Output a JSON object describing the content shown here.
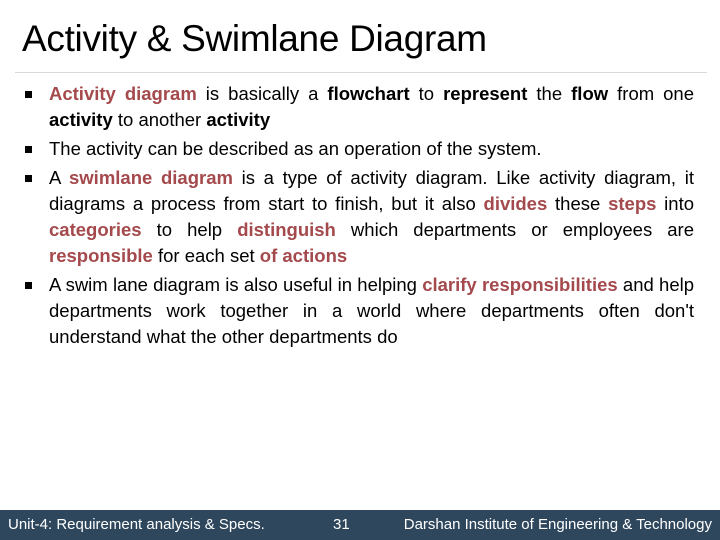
{
  "slide": {
    "title": "Activity & Swimlane Diagram",
    "bullets": [
      {
        "segments": [
          {
            "text": "Activity diagram",
            "style": "highlight"
          },
          {
            "text": " is basically a ",
            "style": "normal"
          },
          {
            "text": "flowchart",
            "style": "bold"
          },
          {
            "text": " to ",
            "style": "normal"
          },
          {
            "text": "represent",
            "style": "bold"
          },
          {
            "text": " the ",
            "style": "normal"
          },
          {
            "text": "flow",
            "style": "bold"
          },
          {
            "text": " from one ",
            "style": "normal"
          },
          {
            "text": "activity",
            "style": "bold"
          },
          {
            "text": " to another ",
            "style": "normal"
          },
          {
            "text": "activity",
            "style": "bold"
          }
        ]
      },
      {
        "segments": [
          {
            "text": "The activity can be described as an operation of the system.",
            "style": "normal"
          }
        ]
      },
      {
        "segments": [
          {
            "text": "A ",
            "style": "normal"
          },
          {
            "text": "swimlane diagram",
            "style": "highlight"
          },
          {
            "text": " is a type of activity diagram. Like activity diagram, it diagrams a process from start to finish, but it also ",
            "style": "normal"
          },
          {
            "text": "divides",
            "style": "highlight"
          },
          {
            "text": " these ",
            "style": "normal"
          },
          {
            "text": "steps",
            "style": "highlight"
          },
          {
            "text": " into ",
            "style": "normal"
          },
          {
            "text": "categories",
            "style": "highlight"
          },
          {
            "text": " to help ",
            "style": "normal"
          },
          {
            "text": "distinguish",
            "style": "highlight"
          },
          {
            "text": " which departments or employees are ",
            "style": "normal"
          },
          {
            "text": "responsible",
            "style": "highlight"
          },
          {
            "text": " for each set ",
            "style": "normal"
          },
          {
            "text": "of actions",
            "style": "highlight"
          }
        ]
      },
      {
        "segments": [
          {
            "text": "A swim lane diagram is also useful in helping ",
            "style": "normal"
          },
          {
            "text": "clarify responsibilities",
            "style": "highlight"
          },
          {
            "text": " and help departments work together in a world where departments often don't understand what the other departments do",
            "style": "normal"
          }
        ]
      }
    ]
  },
  "footer": {
    "unit": "Unit-4: Requirement analysis & Specs.",
    "page_number": "31",
    "institute": "Darshan Institute of Engineering & Technology"
  },
  "colors": {
    "highlight": "#a4494c",
    "footer_background": "#2e475d",
    "divider": "#d9d9d9"
  }
}
